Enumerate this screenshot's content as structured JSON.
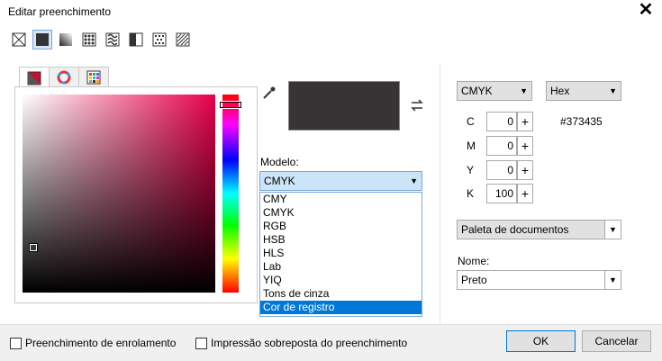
{
  "window": {
    "title": "Editar preenchimento",
    "close_icon": "close-icon"
  },
  "fill_types": [
    {
      "name": "no-fill-icon",
      "selected": false
    },
    {
      "name": "uniform-fill-icon",
      "selected": true
    },
    {
      "name": "fountain-fill-icon",
      "selected": false
    },
    {
      "name": "vector-pattern-icon",
      "selected": false
    },
    {
      "name": "bitmap-pattern-icon",
      "selected": false
    },
    {
      "name": "two-color-pattern-icon",
      "selected": false
    },
    {
      "name": "texture-fill-icon",
      "selected": false
    },
    {
      "name": "postscript-fill-icon",
      "selected": false
    }
  ],
  "tabs": [
    {
      "name": "color-viewers-tab",
      "active": true
    },
    {
      "name": "color-harmonies-tab",
      "active": false
    },
    {
      "name": "color-palettes-tab",
      "active": false
    }
  ],
  "color": {
    "swatch": "#373435"
  },
  "modelo": {
    "label": "Modelo:",
    "selected": "CMYK",
    "options": [
      "CMY",
      "CMYK",
      "RGB",
      "HSB",
      "HLS",
      "Lab",
      "YIQ",
      "Tons de cinza",
      "Cor de registro"
    ],
    "highlighted": "Cor de registro"
  },
  "right": {
    "model_combo": "CMYK",
    "format_combo": "Hex",
    "hex_value": "#373435",
    "channels": [
      {
        "label": "C",
        "value": "0"
      },
      {
        "label": "M",
        "value": "0"
      },
      {
        "label": "Y",
        "value": "0"
      },
      {
        "label": "K",
        "value": "100"
      }
    ],
    "palette": "Paleta de documentos",
    "nome_label": "Nome:",
    "nome_value": "Preto"
  },
  "footer": {
    "wrap_fill": "Preenchimento de enrolamento",
    "overprint_fill": "Impressão sobreposta do preenchimento",
    "ok": "OK",
    "cancel": "Cancelar"
  }
}
